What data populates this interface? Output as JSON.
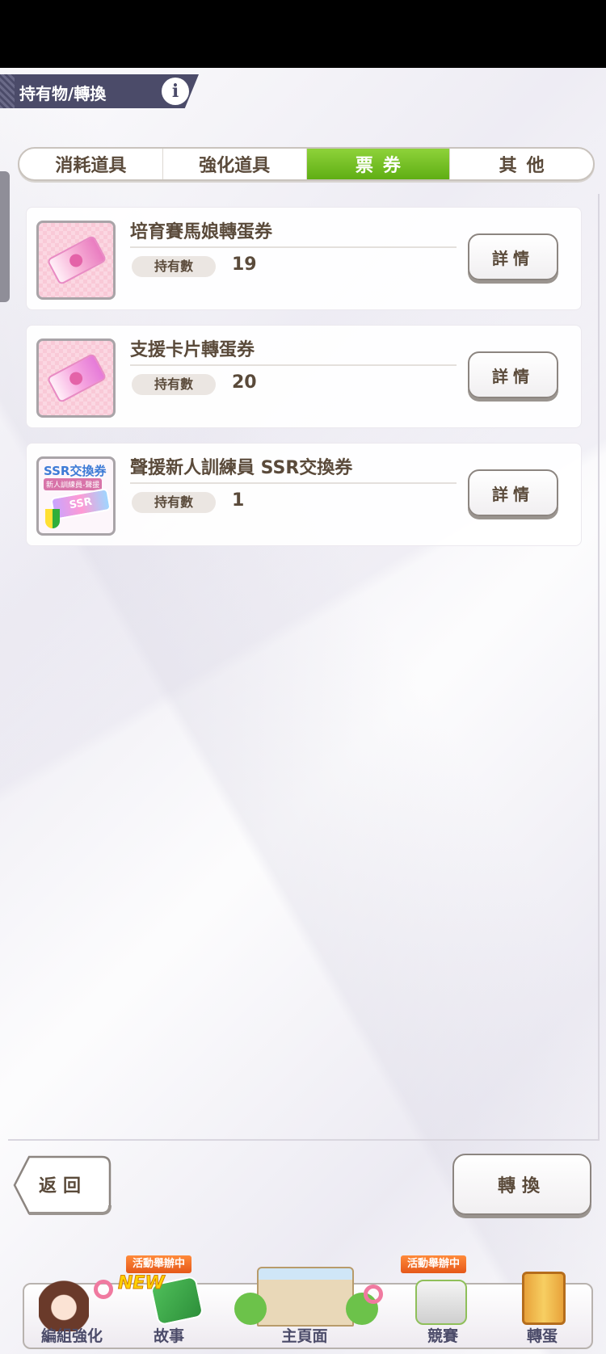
{
  "header": {
    "title": "持有物/轉換",
    "info_icon": "info-icon"
  },
  "tabs": [
    {
      "label": "消耗道具",
      "active": false
    },
    {
      "label": "強化道具",
      "active": false
    },
    {
      "label": "票券",
      "active": true
    },
    {
      "label": "其他",
      "active": false
    }
  ],
  "items": [
    {
      "name": "培育賽馬娘轉蛋券",
      "qty_label": "持有數",
      "qty": "19",
      "detail_label": "詳情",
      "icon": "pink-ticket-icon"
    },
    {
      "name": "支援卡片轉蛋券",
      "qty_label": "持有數",
      "qty": "20",
      "detail_label": "詳情",
      "icon": "pink-ticket-icon"
    },
    {
      "name": "聲援新人訓練員 SSR交換券",
      "qty_label": "持有數",
      "qty": "1",
      "detail_label": "詳情",
      "icon": "ssr-ticket-icon",
      "icon_text": {
        "title": "SSR交換券",
        "subtitle": "新人訓練員-聲援",
        "ticket": "SSR"
      }
    }
  ],
  "footer": {
    "back_label": "返回",
    "convert_label": "轉換"
  },
  "nav": {
    "items": [
      {
        "label": "編組強化"
      },
      {
        "label": "故事",
        "badge": "活動舉辦中",
        "new": "NEW"
      },
      {
        "label": "主頁面"
      },
      {
        "label": "競賽",
        "badge": "活動舉辦中"
      },
      {
        "label": "轉蛋"
      }
    ]
  },
  "colors": {
    "active_tab": "#6cbc1e",
    "title_bar": "#4b4b69",
    "text": "#5a4a3a"
  }
}
